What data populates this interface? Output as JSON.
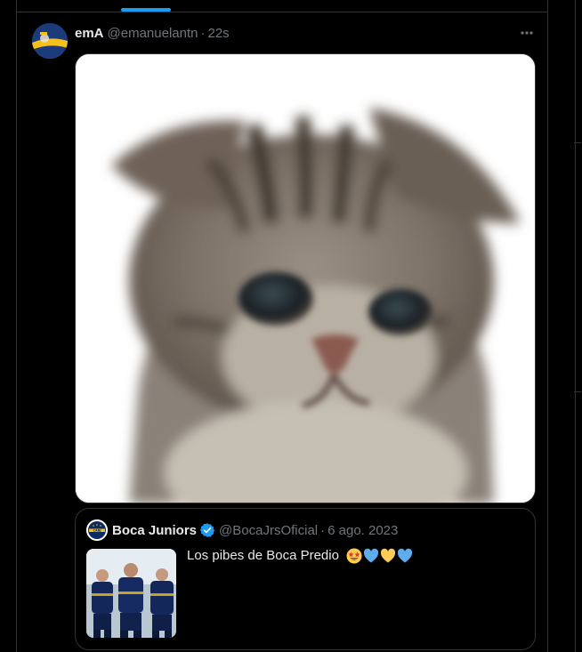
{
  "tweet": {
    "display_name": "emA",
    "handle": "@emanuelantn",
    "separator": "·",
    "time": "22s",
    "more_icon": "more-dots-icon",
    "media_alt_icon": "sad-kitten-image"
  },
  "quoted_tweet": {
    "display_name": "Boca Juniors",
    "verified": true,
    "handle": "@BocaJrsOficial",
    "separator": "·",
    "date": "6 ago. 2023",
    "text": "Los pibes de Boca Predio",
    "emojis": [
      "star-struck-emoji",
      "blue-heart-emoji",
      "yellow-heart-emoji",
      "blue-heart-emoji"
    ],
    "thumbnail_icon": "players-photo"
  },
  "colors": {
    "accent": "#1d9bf0",
    "background": "#000000",
    "border": "#2f3336",
    "text_primary": "#e7e9ea",
    "text_secondary": "#71767b"
  }
}
